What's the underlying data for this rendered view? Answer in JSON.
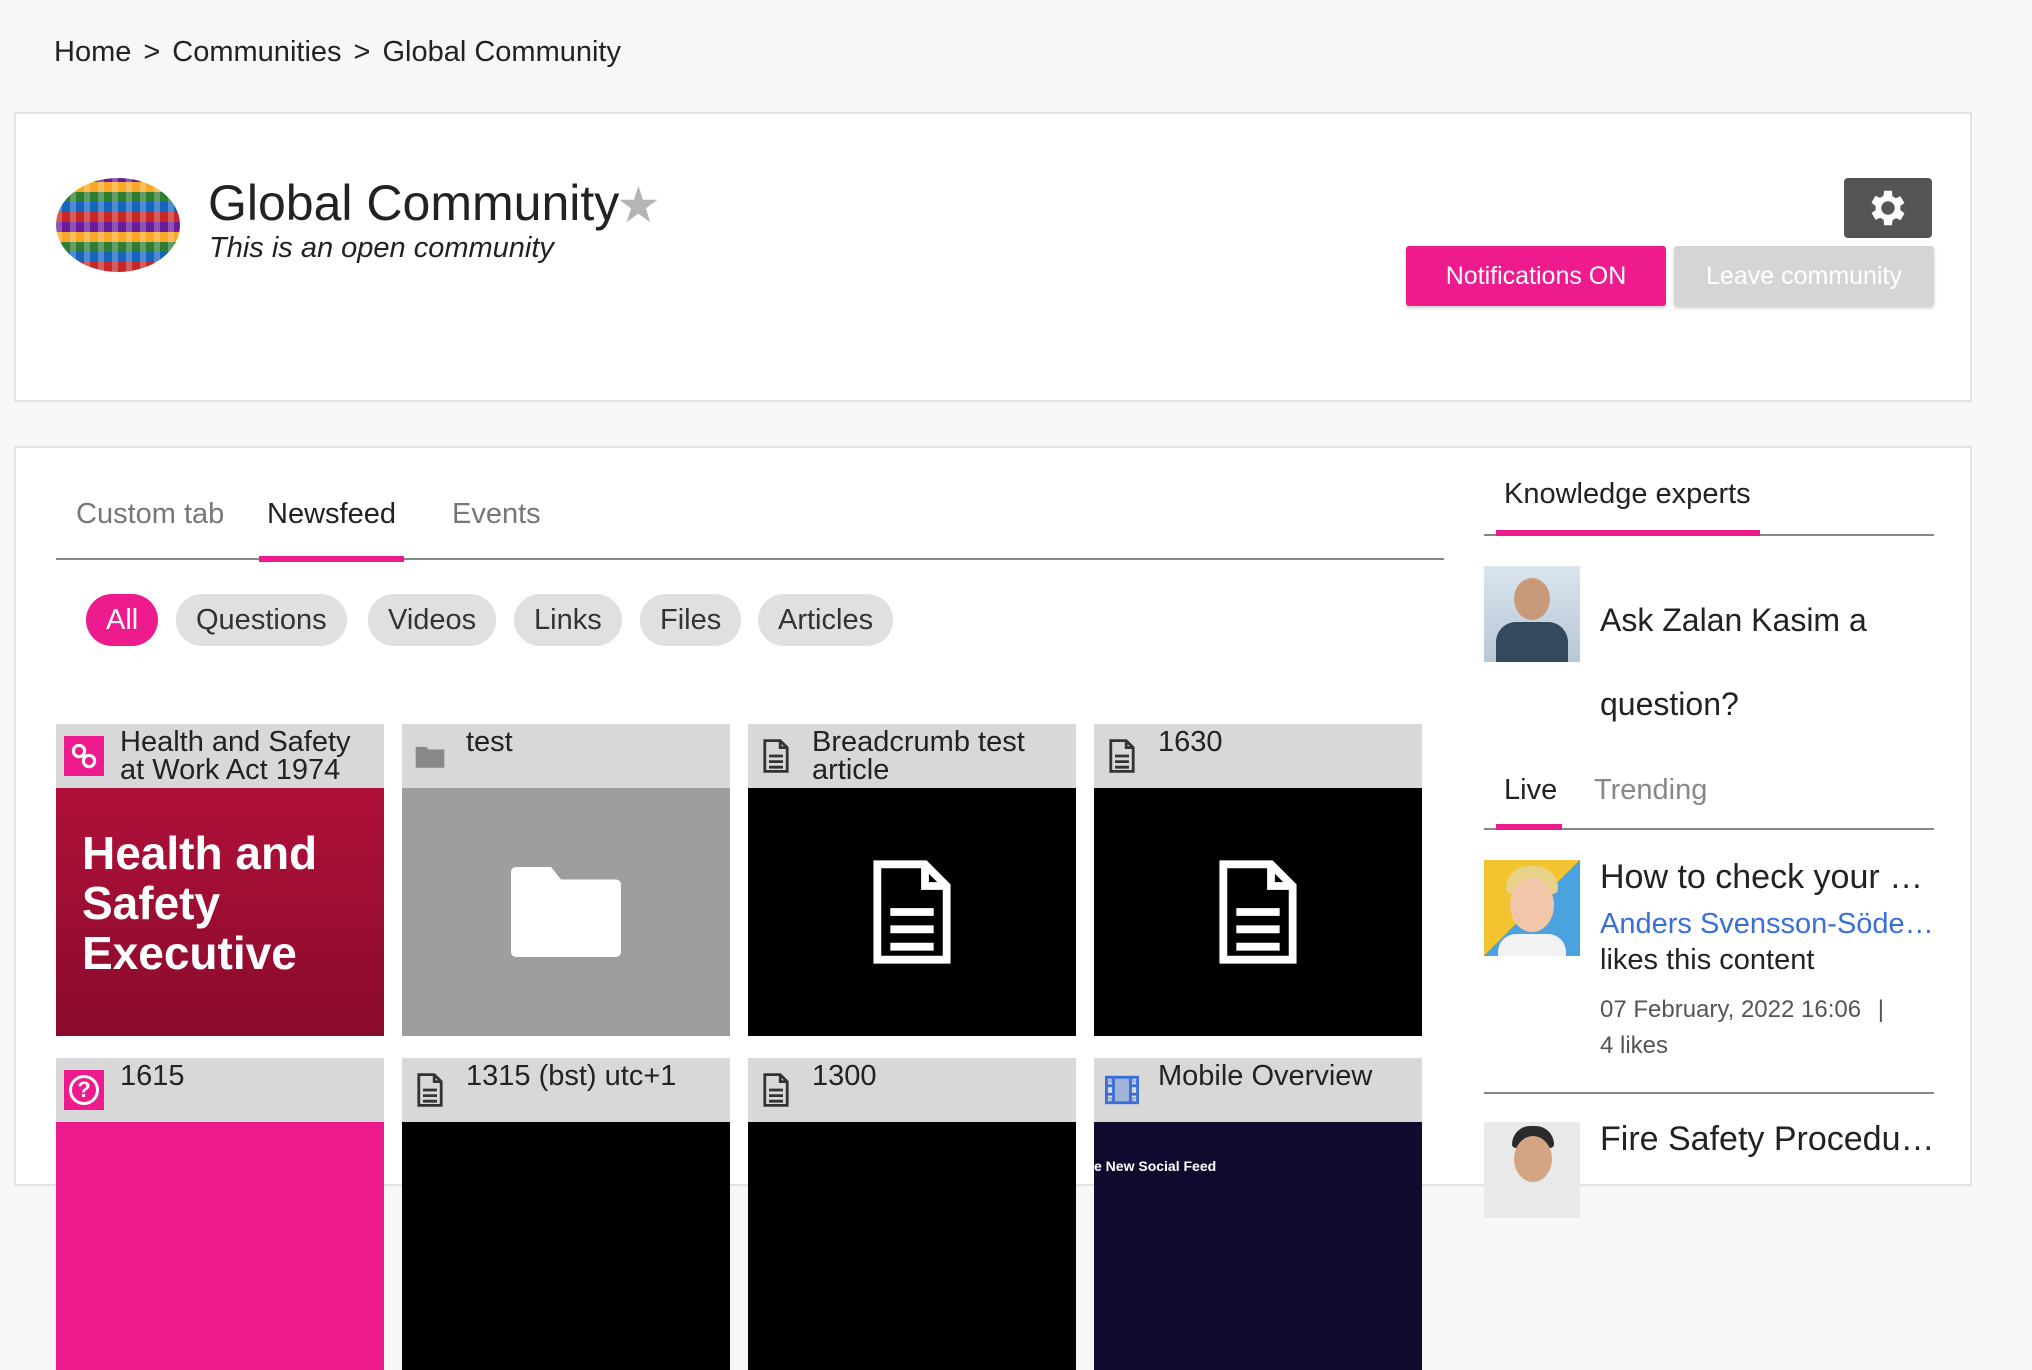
{
  "breadcrumb": {
    "home": "Home",
    "communities": "Communities",
    "current": "Global Community",
    "separator": ">"
  },
  "community": {
    "title": "Global Community",
    "subtitle": "This is an open community",
    "notifications_label": "Notifications ON",
    "leave_label": "Leave community"
  },
  "tabs": [
    "Custom tab",
    "Newsfeed",
    "Events"
  ],
  "active_tab": "Newsfeed",
  "filters": [
    "All",
    "Questions",
    "Videos",
    "Links",
    "Files",
    "Articles"
  ],
  "active_filter": "All",
  "tiles": [
    {
      "title": "Health and Safety at Work Act 1974",
      "icon": "link-icon",
      "body_text": "Health and Safety Executive"
    },
    {
      "title": "test",
      "icon": "folder-icon"
    },
    {
      "title": "Breadcrumb test article",
      "icon": "document-icon"
    },
    {
      "title": "1630",
      "icon": "document-icon"
    },
    {
      "title": "1615",
      "icon": "question-icon"
    },
    {
      "title": "1315 (bst) utc+1",
      "icon": "document-icon"
    },
    {
      "title": "1300",
      "icon": "document-icon"
    },
    {
      "title": "Mobile Overview",
      "icon": "video-icon",
      "body_text": "e New Social Feed"
    }
  ],
  "sidebar": {
    "experts_title": "Knowledge experts",
    "expert_prompt": "Ask Zalan Kasim a question?",
    "feed_tabs": [
      "Live",
      "Trending"
    ],
    "feed": [
      {
        "title": "How to check your n...",
        "user": "Anders Svensson-Söder...",
        "action": "likes this content",
        "date": "07 February, 2022 16:06",
        "separator": "|",
        "likes": "4 likes"
      },
      {
        "title": "Fire Safety Procedur..."
      }
    ]
  },
  "colors": {
    "accent": "#ee1b8f",
    "gear_button": "#555555",
    "leave_button": "#d5d5d5",
    "link": "#3a6fd8"
  }
}
